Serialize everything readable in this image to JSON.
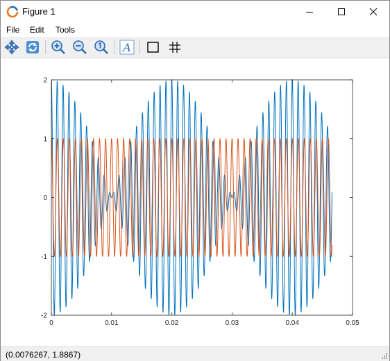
{
  "window": {
    "title": "Figure 1",
    "controls": [
      "minimize-icon",
      "maximize-icon",
      "close-icon"
    ]
  },
  "menu": {
    "items": [
      "File",
      "Edit",
      "Tools"
    ]
  },
  "toolbar": {
    "buttons": [
      "pan-icon",
      "rotate-icon",
      "zoom-in-icon",
      "zoom-out-icon",
      "zoom-reset-icon",
      "text-insert-icon",
      "axes-box-icon",
      "grid-icon"
    ]
  },
  "status": {
    "coordinates": "(0.0076267, 1.8867)"
  },
  "chart_data": {
    "type": "line",
    "xlim": [
      0,
      0.05
    ],
    "ylim": [
      -2,
      2
    ],
    "x_ticks": [
      "0",
      "0.01",
      "0.02",
      "0.03",
      "0.04",
      "0.05"
    ],
    "y_ticks": [
      "2",
      "1",
      "0",
      "-1",
      "-2"
    ],
    "grid": false,
    "x_range_plotted": [
      0,
      0.0466
    ],
    "series": [
      {
        "color": "#0072bd",
        "formula": "cos(2*pi*1000*t) + cos(2*pi*1050*t)",
        "components": [
          {
            "amplitude": 1,
            "frequency_hz": 1000
          },
          {
            "amplitude": 1,
            "frequency_hz": 1050
          }
        ]
      },
      {
        "color": "#d95319",
        "formula": "cos(2*pi*1000*t)",
        "components": [
          {
            "amplitude": 1,
            "frequency_hz": 1000
          }
        ]
      }
    ]
  }
}
